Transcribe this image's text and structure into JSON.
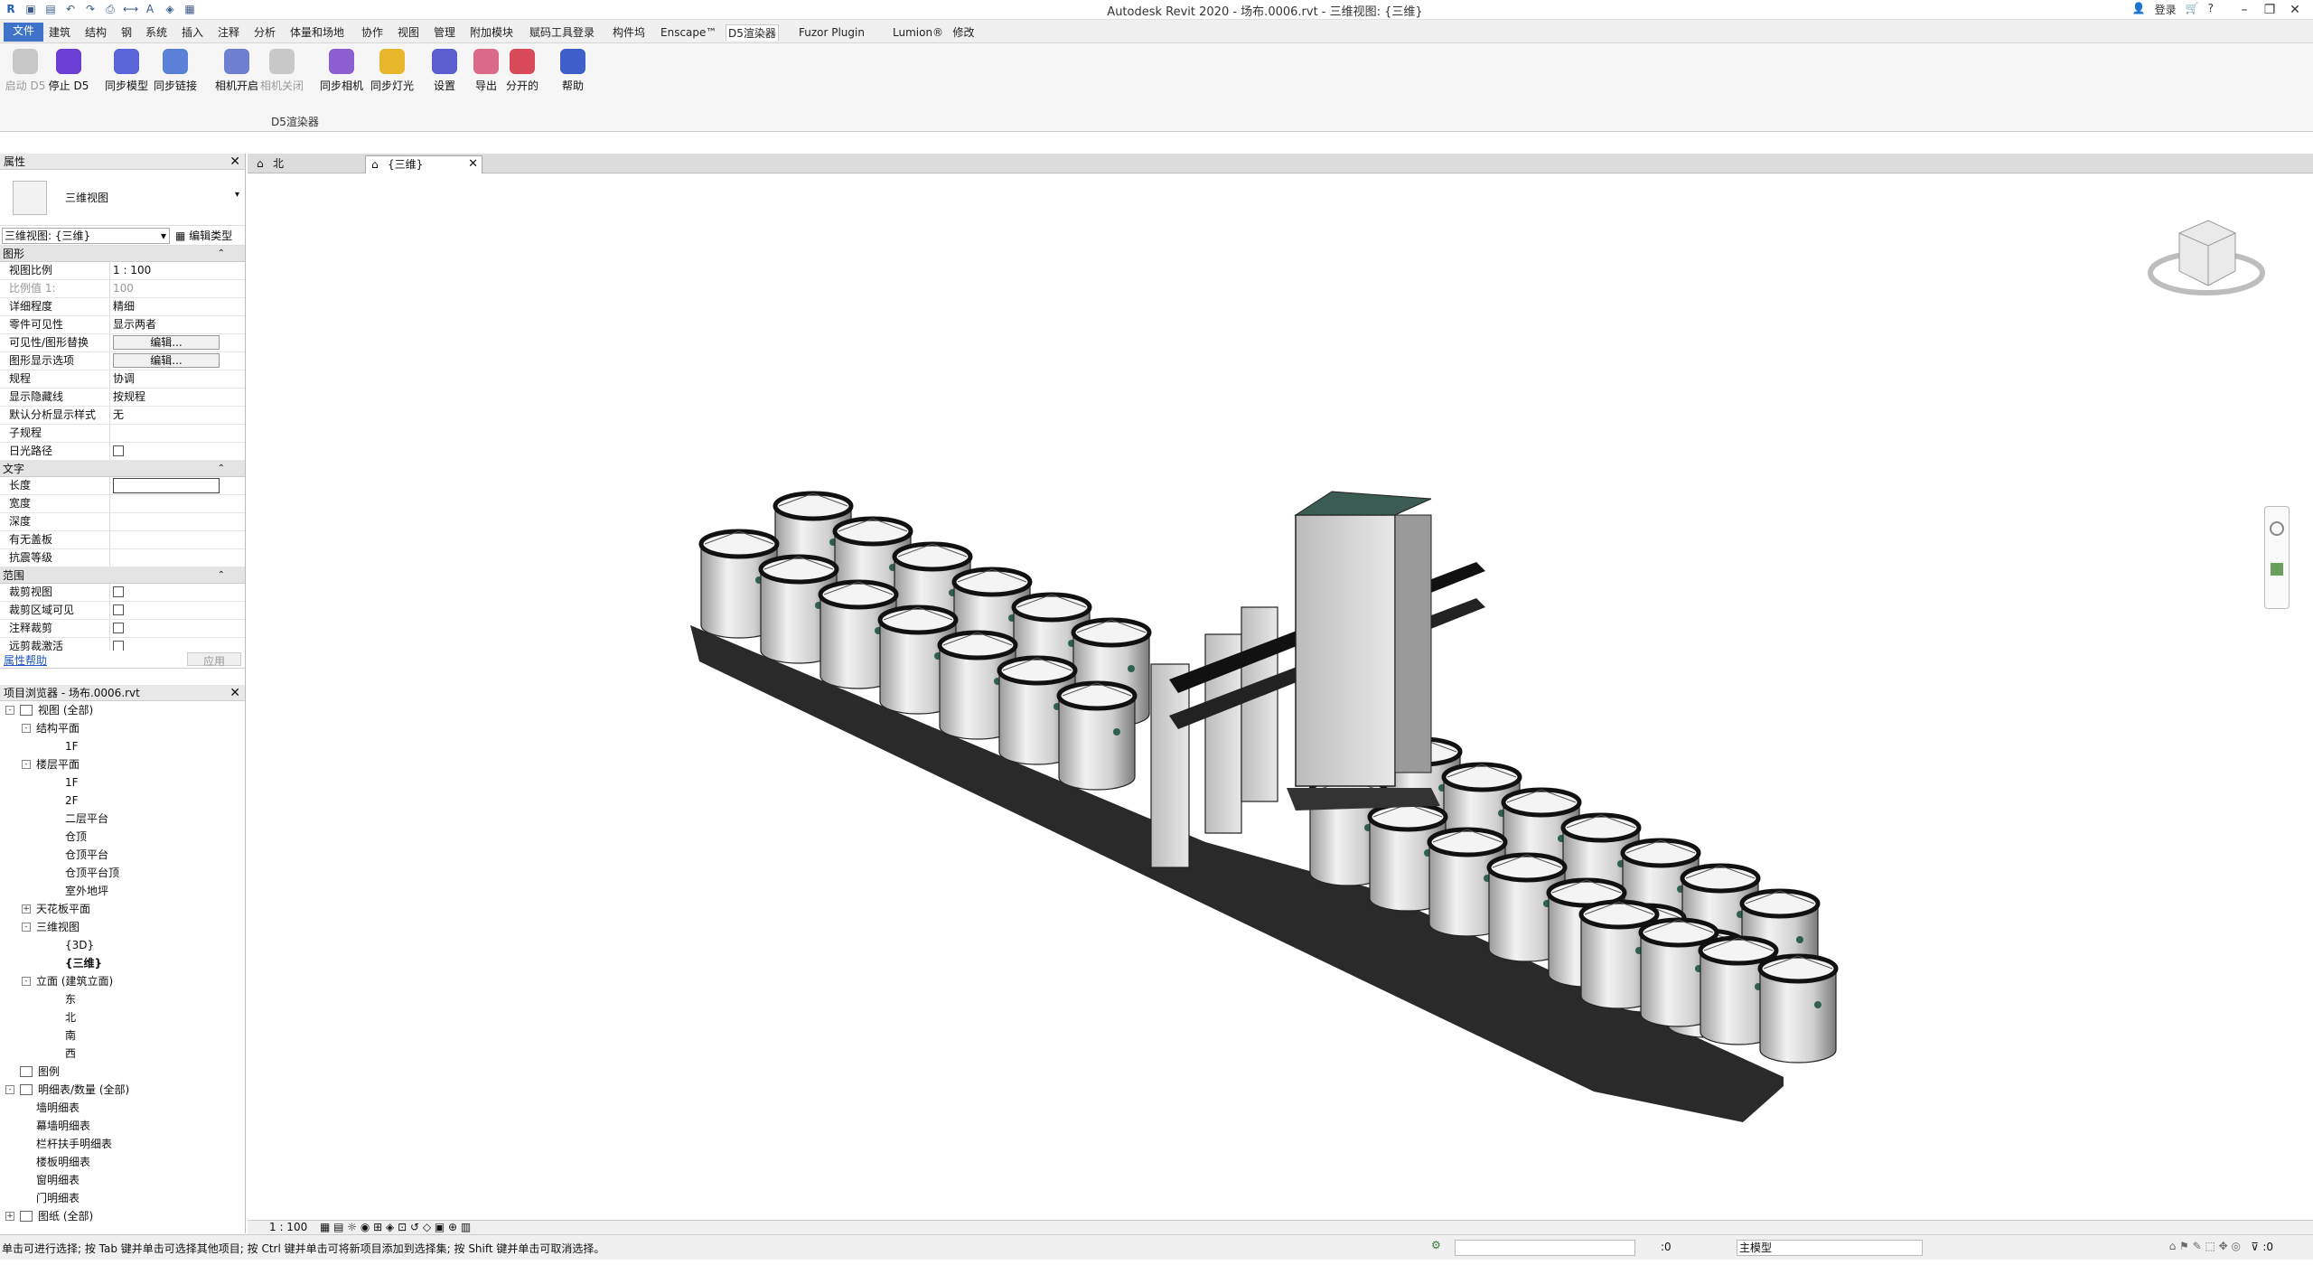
{
  "title_bar": {
    "title": "Autodesk Revit 2020 - 场布.0006.rvt - 三维视图: {三维}",
    "login": "登录"
  },
  "menu": {
    "tabs": [
      "文件",
      "建筑",
      "结构",
      "钢",
      "系统",
      "插入",
      "注释",
      "分析",
      "体量和场地",
      "协作",
      "视图",
      "管理",
      "附加模块",
      "赋码工具登录",
      "构件坞",
      "Enscape™",
      "D5渲染器",
      "Fuzor Plugin",
      "Lumion®",
      "修改"
    ],
    "active": "D5渲染器"
  },
  "ribbon": {
    "buttons": [
      {
        "label": "启动 D5",
        "enabled": false,
        "color": "#c8c8c8"
      },
      {
        "label": "停止 D5",
        "enabled": true,
        "color": "#6b3fd3"
      },
      {
        "label": "同步模型",
        "enabled": true,
        "color": "#5a66d8"
      },
      {
        "label": "同步链接",
        "enabled": true,
        "color": "#5a80d8"
      },
      {
        "label": "相机开启",
        "enabled": true,
        "color": "#6f7fcf"
      },
      {
        "label": "相机关闭",
        "enabled": false,
        "color": "#c8c8c8"
      },
      {
        "label": "同步相机",
        "enabled": true,
        "color": "#8b5fcf"
      },
      {
        "label": "同步灯光",
        "enabled": true,
        "color": "#e8b62a"
      },
      {
        "label": "设置",
        "enabled": true,
        "color": "#5b5fcf"
      },
      {
        "label": "导出",
        "enabled": true,
        "color": "#d96a8a"
      },
      {
        "label": "分开的",
        "enabled": true,
        "color": "#d94a5a"
      },
      {
        "label": "帮助",
        "enabled": true,
        "color": "#3f5ec9"
      }
    ],
    "panel_name": "D5渲染器"
  },
  "properties": {
    "header": "属性",
    "type_name": "三维视图",
    "selector": "三维视图: {三维}",
    "edit_type": "编辑类型",
    "sections": {
      "graphics": "图形",
      "text": "文字",
      "extents": "范围"
    },
    "graphics_rows": [
      {
        "k": "视图比例",
        "v": "1 : 100",
        "type": "text"
      },
      {
        "k": "比例值 1:",
        "v": "100",
        "type": "dim"
      },
      {
        "k": "详细程度",
        "v": "精细",
        "type": "text"
      },
      {
        "k": "零件可见性",
        "v": "显示两者",
        "type": "text"
      },
      {
        "k": "可见性/图形替换",
        "v": "编辑...",
        "type": "button"
      },
      {
        "k": "图形显示选项",
        "v": "编辑...",
        "type": "button"
      },
      {
        "k": "规程",
        "v": "协调",
        "type": "text"
      },
      {
        "k": "显示隐藏线",
        "v": "按规程",
        "type": "text"
      },
      {
        "k": "默认分析显示样式",
        "v": "无",
        "type": "text"
      },
      {
        "k": "子规程",
        "v": "",
        "type": "text"
      },
      {
        "k": "日光路径",
        "v": "",
        "type": "check"
      }
    ],
    "text_rows": [
      {
        "k": "长度",
        "v": "",
        "type": "input"
      },
      {
        "k": "宽度",
        "v": "",
        "type": "text"
      },
      {
        "k": "深度",
        "v": "",
        "type": "text"
      },
      {
        "k": "有无盖板",
        "v": "",
        "type": "text"
      },
      {
        "k": "抗震等级",
        "v": "",
        "type": "text"
      }
    ],
    "extents_rows": [
      {
        "k": "裁剪视图",
        "v": "",
        "type": "check"
      },
      {
        "k": "裁剪区域可见",
        "v": "",
        "type": "check"
      },
      {
        "k": "注释裁剪",
        "v": "",
        "type": "check"
      },
      {
        "k": "远剪裁激活",
        "v": "",
        "type": "check"
      }
    ],
    "help_link": "属性帮助",
    "apply": "应用"
  },
  "browser": {
    "header": "项目浏览器 - 场布.0006.rvt",
    "nodes": [
      {
        "label": "视图 (全部)",
        "level": 0,
        "toggle": "-",
        "icon": true
      },
      {
        "label": "结构平面",
        "level": 1,
        "toggle": "-"
      },
      {
        "label": "1F",
        "level": 2
      },
      {
        "label": "楼层平面",
        "level": 1,
        "toggle": "-"
      },
      {
        "label": "1F",
        "level": 2
      },
      {
        "label": "2F",
        "level": 2
      },
      {
        "label": "二层平台",
        "level": 2
      },
      {
        "label": "仓顶",
        "level": 2
      },
      {
        "label": "仓顶平台",
        "level": 2
      },
      {
        "label": "仓顶平台顶",
        "level": 2
      },
      {
        "label": "室外地坪",
        "level": 2
      },
      {
        "label": "天花板平面",
        "level": 1,
        "toggle": "+"
      },
      {
        "label": "三维视图",
        "level": 1,
        "toggle": "-"
      },
      {
        "label": "{3D}",
        "level": 2
      },
      {
        "label": "{三维}",
        "level": 2,
        "bold": true
      },
      {
        "label": "立面 (建筑立面)",
        "level": 1,
        "toggle": "-"
      },
      {
        "label": "东",
        "level": 2
      },
      {
        "label": "北",
        "level": 2
      },
      {
        "label": "南",
        "level": 2
      },
      {
        "label": "西",
        "level": 2
      },
      {
        "label": "图例",
        "level": 0,
        "icon": true
      },
      {
        "label": "明细表/数量 (全部)",
        "level": 0,
        "toggle": "-",
        "icon": true
      },
      {
        "label": "墙明细表",
        "level": 1
      },
      {
        "label": "幕墙明细表",
        "level": 1
      },
      {
        "label": "栏杆扶手明细表",
        "level": 1
      },
      {
        "label": "楼板明细表",
        "level": 1
      },
      {
        "label": "窗明细表",
        "level": 1
      },
      {
        "label": "门明细表",
        "level": 1
      },
      {
        "label": "图纸 (全部)",
        "level": 0,
        "toggle": "+",
        "icon": true
      }
    ]
  },
  "view_tabs": [
    {
      "label": "北",
      "active": false
    },
    {
      "label": "{三维}",
      "active": true
    }
  ],
  "view_control": {
    "scale": "1 : 100"
  },
  "status": {
    "message": "单击可进行选择; 按 Tab 键并单击可选择其他项目; 按 Ctrl 键并单击可将新项目添加到选择集; 按 Shift 键并单击可取消选择。",
    "zero": ":0",
    "model": "主模型",
    "filter": ":0"
  }
}
